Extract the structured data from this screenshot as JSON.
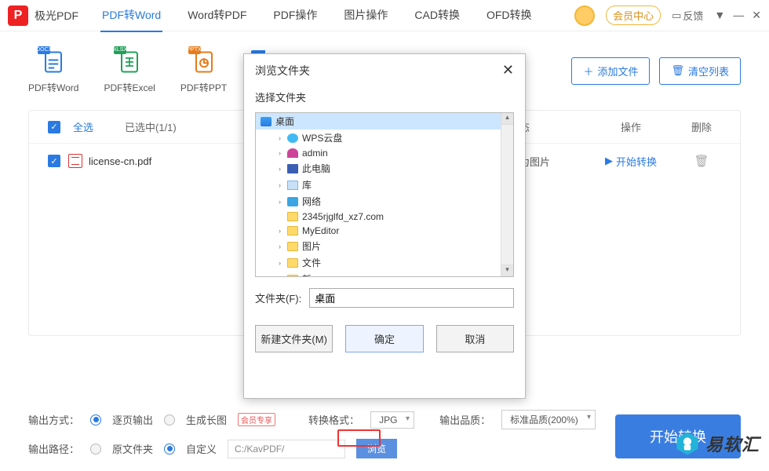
{
  "app": {
    "name": "极光PDF"
  },
  "tabs": {
    "t0": "PDF转Word",
    "t1": "Word转PDF",
    "t2": "PDF操作",
    "t3": "图片操作",
    "t4": "CAD转换",
    "t5": "OFD转换"
  },
  "titlebar": {
    "member": "会员中心",
    "feedback": "反馈"
  },
  "tools": {
    "t0": {
      "label": "PDF转Word",
      "badge": "DOCX"
    },
    "t1": {
      "label": "PDF转Excel",
      "badge": "XLSX"
    },
    "t2": {
      "label": "PDF转PPT",
      "badge": "PPTX"
    },
    "add": "添加文件",
    "clear": "清空列表"
  },
  "list": {
    "selectAll": "全选",
    "selected": "已选中(1/1)",
    "colStatus": "状态",
    "colAction": "操作",
    "colDelete": "删除",
    "row0": {
      "name": "license-cn.pdf",
      "convertTo": "换为图片",
      "action": "开始转换"
    }
  },
  "bottom": {
    "outModeLabel": "输出方式：",
    "optPage": "逐页输出",
    "optLong": "生成长图",
    "vip": "会员专享",
    "fmtLabel": "转换格式：",
    "fmtValue": "JPG",
    "qualLabel": "输出品质：",
    "qualValue": "标准品质(200%)",
    "pathLabel": "输出路径：",
    "optOrig": "原文件夹",
    "optCustom": "自定义",
    "pathValue": "C:/KavPDF/",
    "browse": "浏览",
    "bigBtn": "开始转换"
  },
  "dialog": {
    "title": "浏览文件夹",
    "subtitle": "选择文件夹",
    "items": {
      "desktop": "桌面",
      "wps": "WPS云盘",
      "admin": "admin",
      "pc": "此电脑",
      "lib": "库",
      "net": "网络",
      "f0": "2345rjglfd_xz7.com",
      "f1": "MyEditor",
      "f2": "图片",
      "f3": "文件",
      "f4": "新"
    },
    "fieldLabel": "文件夹(F):",
    "fieldValue": "桌面",
    "btnNew": "新建文件夹(M)",
    "btnOk": "确定",
    "btnCancel": "取消"
  },
  "watermark": "易软汇"
}
